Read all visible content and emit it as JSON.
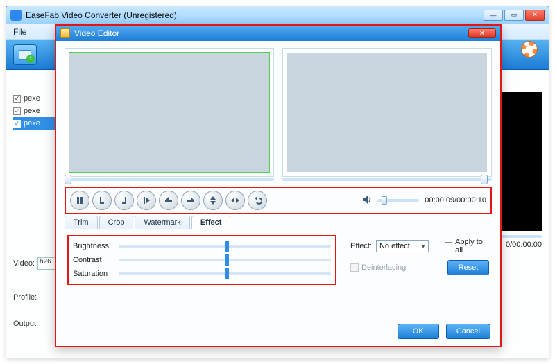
{
  "app": {
    "title": "EaseFab Video Converter (Unregistered)",
    "menu": {
      "file": "File"
    }
  },
  "files": {
    "items": [
      {
        "label": "pexe",
        "checked": true
      },
      {
        "label": "pexe",
        "checked": true
      },
      {
        "label": "pexe",
        "checked": true,
        "selected": true
      }
    ]
  },
  "bottom": {
    "video_label": "Video:",
    "video_value": "h26",
    "profile_label": "Profile:",
    "output_label": "Output:"
  },
  "main_preview": {
    "time": "0/00:00:00"
  },
  "editor": {
    "title": "Video Editor",
    "time": "00:00:09/00:00:10",
    "tabs": {
      "trim": "Trim",
      "crop": "Crop",
      "watermark": "Watermark",
      "effect": "Effect",
      "active": "effect"
    },
    "sliders": {
      "brightness_label": "Brightness",
      "contrast_label": "Contrast",
      "saturation_label": "Saturation"
    },
    "effect_label": "Effect:",
    "effect_value": "No effect",
    "apply_label": "Apply to all",
    "deinterlacing_label": "Deinterlacing",
    "reset_label": "Reset",
    "ok_label": "OK",
    "cancel_label": "Cancel"
  }
}
